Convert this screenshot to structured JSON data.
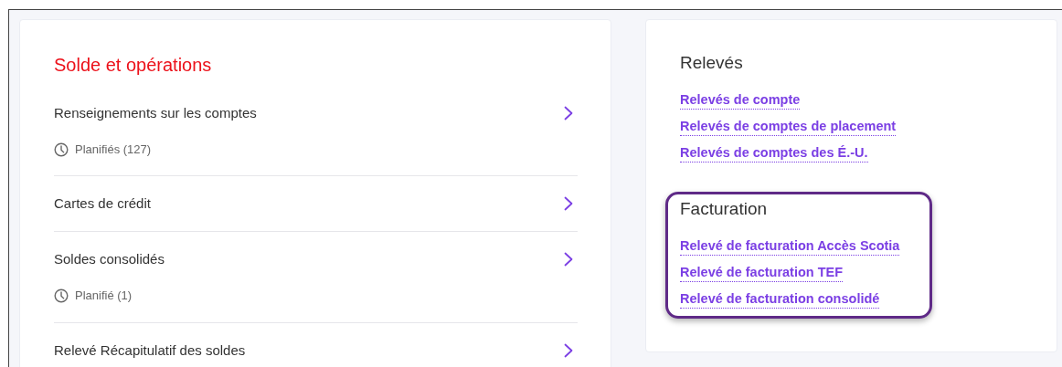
{
  "balances": {
    "title": "Solde et opérations",
    "items": [
      {
        "label": "Renseignements sur les comptes",
        "note": "Planifiés (127)"
      },
      {
        "label": "Cartes de crédit"
      },
      {
        "label": "Soldes consolidés",
        "note": "Planifié (1)"
      },
      {
        "label": "Relevé Récapitulatif des soldes"
      }
    ]
  },
  "statements": {
    "sections": [
      {
        "title": "Relevés",
        "highlighted": false,
        "links": [
          "Relevés de compte",
          "Relevés de comptes de placement",
          "Relevés de comptes des É.-U."
        ]
      },
      {
        "title": "Facturation",
        "highlighted": true,
        "links": [
          "Relevé de facturation Accès Scotia",
          "Relevé de facturation TEF",
          "Relevé de facturation consolidé"
        ]
      }
    ]
  }
}
